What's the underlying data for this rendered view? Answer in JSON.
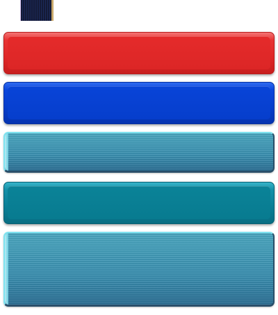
{
  "colors": {
    "red_button": "#e02828",
    "blue_button": "#063ecc",
    "striped_button": "#3a8fb0",
    "teal_button": "#0a7f96",
    "thumbnail": "#141a36"
  },
  "buttons": [
    {
      "style": "red-glossy",
      "label": ""
    },
    {
      "style": "blue-glossy",
      "label": ""
    },
    {
      "style": "teal-striped",
      "label": ""
    },
    {
      "style": "teal-glossy",
      "label": ""
    },
    {
      "style": "teal-striped-tall",
      "label": ""
    }
  ]
}
